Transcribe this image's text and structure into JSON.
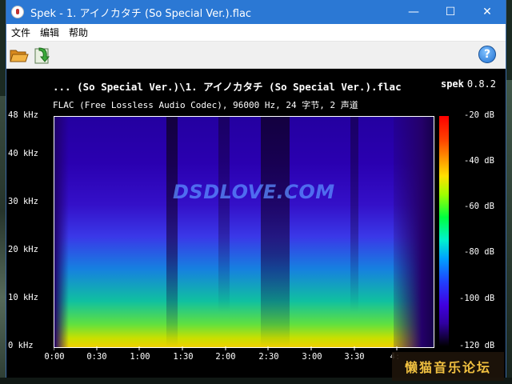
{
  "window": {
    "title": "Spek - 1. アイノカタチ (So Special Ver.).flac",
    "minimize": "—",
    "maximize": "☐",
    "close": "✕"
  },
  "menu": {
    "items": [
      "文件",
      "编辑",
      "帮助"
    ]
  },
  "toolbar": {
    "help": "?"
  },
  "plot": {
    "file_title": "... (So Special Ver.)\\1. アイノカタチ (So Special Ver.).flac",
    "app_name": "spek",
    "version": "0.8.2",
    "file_info": "FLAC (Free Lossless Audio Codec), 96000 Hz, 24 字节, 2 声道",
    "freq_labels": [
      "48 kHz",
      "40 kHz",
      "30 kHz",
      "20 kHz",
      "10 kHz",
      "0 kHz"
    ],
    "time_labels": [
      "0:00",
      "0:30",
      "1:00",
      "1:30",
      "2:00",
      "2:30",
      "3:00",
      "3:30",
      "4:"
    ],
    "db_labels": [
      "-20 dB",
      "-40 dB",
      "-60 dB",
      "-80 dB",
      "-100 dB",
      "-120 dB"
    ],
    "watermark": "DSDLOVE.COM"
  },
  "corner_logo": "懒猫音乐论坛",
  "colors": {
    "titlebar": "#2b78d4",
    "plot_bg": "#000000"
  }
}
